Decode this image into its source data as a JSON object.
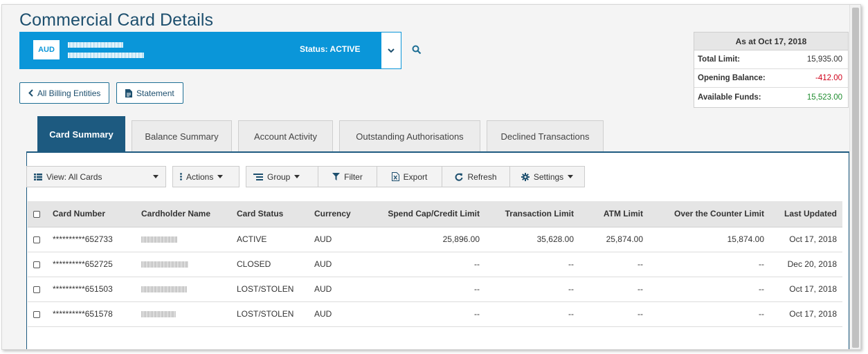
{
  "page": {
    "title": "Commercial Card Details"
  },
  "account": {
    "currency": "AUD",
    "status_label": "Status: ACTIVE"
  },
  "summary_box": {
    "heading": "As at Oct 17, 2018",
    "rows": [
      {
        "label": "Total Limit:",
        "value": "15,935.00",
        "tone": "normal"
      },
      {
        "label": "Opening Balance:",
        "value": "-412.00",
        "tone": "negative"
      },
      {
        "label": "Available Funds:",
        "value": "15,523.00",
        "tone": "positive"
      }
    ]
  },
  "nav": {
    "back_label": "All Billing Entities",
    "statement_label": "Statement"
  },
  "tabs": [
    {
      "label": "Card Summary",
      "active": true
    },
    {
      "label": "Balance Summary",
      "active": false
    },
    {
      "label": "Account Activity",
      "active": false
    },
    {
      "label": "Outstanding Authorisations",
      "active": false
    },
    {
      "label": "Declined Transactions",
      "active": false
    }
  ],
  "toolbar": {
    "view_label": "View: All Cards",
    "actions_label": "Actions",
    "group_label": "Group",
    "filter_label": "Filter",
    "export_label": "Export",
    "refresh_label": "Refresh",
    "settings_label": "Settings"
  },
  "table": {
    "columns": [
      "Card Number",
      "Cardholder Name",
      "Card Status",
      "Currency",
      "Spend Cap/Credit Limit",
      "Transaction Limit",
      "ATM Limit",
      "Over the Counter Limit",
      "Last Updated"
    ],
    "rows": [
      {
        "card_number": "**********652733",
        "status": "ACTIVE",
        "currency": "AUD",
        "spend_cap": "25,896.00",
        "txn_limit": "35,628.00",
        "atm_limit": "25,874.00",
        "otc_limit": "15,874.00",
        "updated": "Oct 17, 2018"
      },
      {
        "card_number": "**********652725",
        "status": "CLOSED",
        "currency": "AUD",
        "spend_cap": "--",
        "txn_limit": "--",
        "atm_limit": "--",
        "otc_limit": "--",
        "updated": "Dec 20, 2018"
      },
      {
        "card_number": "**********651503",
        "status": "LOST/STOLEN",
        "currency": "AUD",
        "spend_cap": "--",
        "txn_limit": "--",
        "atm_limit": "--",
        "otc_limit": "--",
        "updated": "Oct 17, 2018"
      },
      {
        "card_number": "**********651578",
        "status": "LOST/STOLEN",
        "currency": "AUD",
        "spend_cap": "--",
        "txn_limit": "--",
        "atm_limit": "--",
        "otc_limit": "--",
        "updated": "Oct 17, 2018"
      }
    ]
  },
  "colors": {
    "brand_blue": "#0a96d9",
    "navy": "#1d5a80",
    "negative": "#d0021b",
    "positive": "#1e8c2e"
  }
}
